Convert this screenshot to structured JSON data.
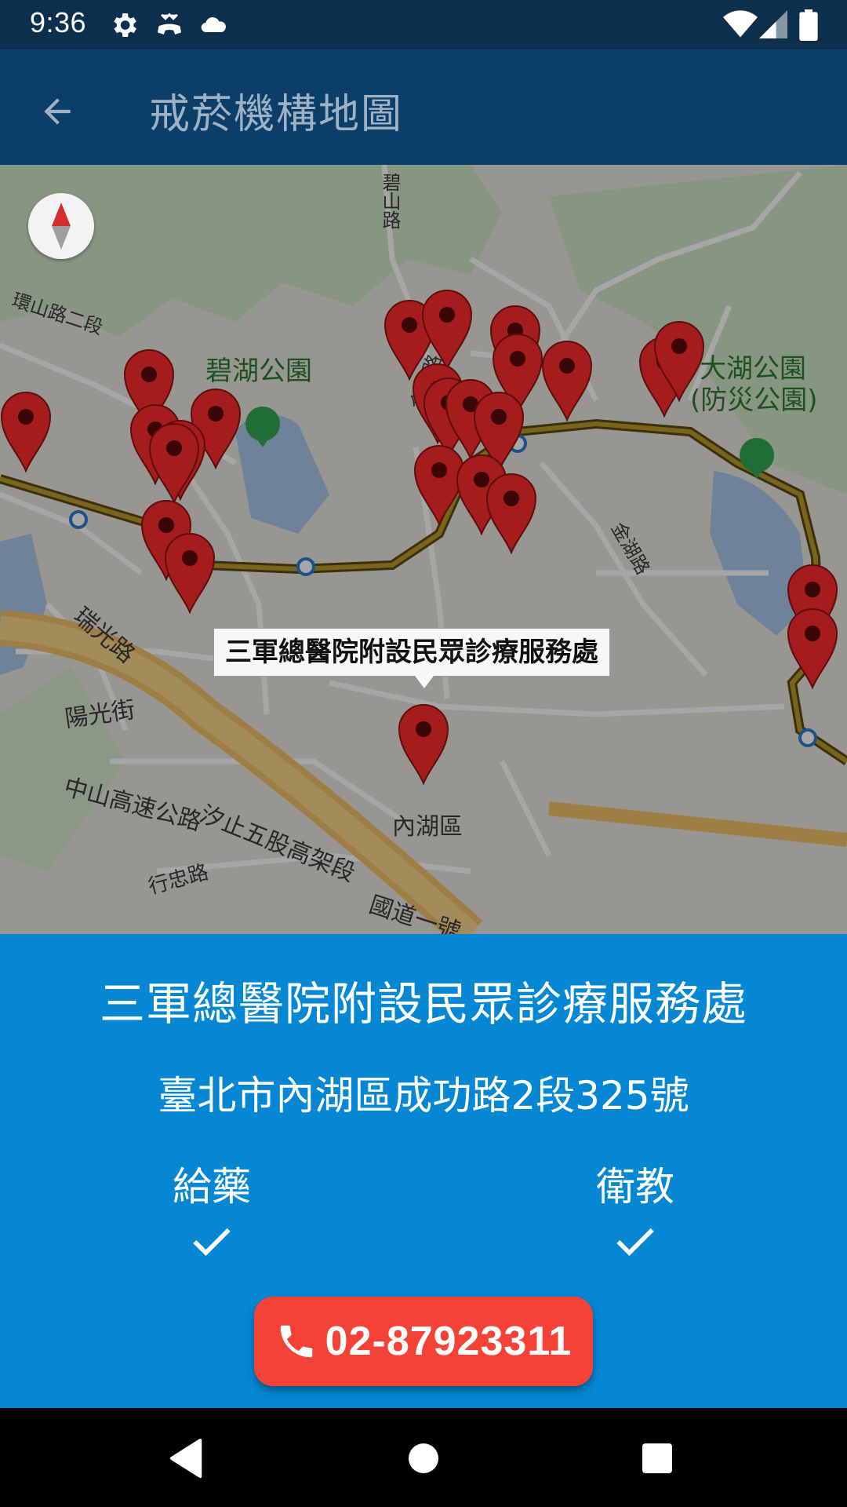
{
  "status_bar": {
    "time": "9:36",
    "icons": [
      "settings-icon",
      "call-end-icon",
      "cloud-icon",
      "wifi-icon",
      "signal-icon",
      "battery-icon"
    ]
  },
  "app_bar": {
    "title": "戒菸機構地圖",
    "back_icon": "arrow-back-icon",
    "background": "#0b3f69"
  },
  "map": {
    "labels": {
      "bishan_rd": "碧山路",
      "huanshan_rd": "環山路二段",
      "jinlong_rd": "金龍路",
      "jinhu_rd": "金湖路",
      "ruiguang_rd": "瑞光路",
      "yangguang_st": "陽光街",
      "zhongshan_fwy": "中山高速公路",
      "xizhi_viaduct": "汐止五股高架段",
      "xingzhong_rd": "行忠路",
      "national_hwy": "國道一號",
      "neihu_district": "內湖區"
    },
    "parks": {
      "bihu": "碧湖公園",
      "dahu_line1": "大湖公園",
      "dahu_line2": "(防災公園)"
    },
    "info_window": "三軍總醫院附設民眾診療服務處",
    "marker_color": "#a51c1c"
  },
  "detail": {
    "name": "三軍總醫院附設民眾診療服務處",
    "address": "臺北市內湖區成功路2段325號",
    "services": [
      {
        "label": "給藥",
        "available": true
      },
      {
        "label": "衛教",
        "available": true
      }
    ],
    "phone": "02-87923311",
    "panel_color": "#0587d4",
    "button_color": "#f44336"
  },
  "nav_bar": {
    "icons": [
      "back-triangle-icon",
      "home-circle-icon",
      "recents-square-icon"
    ]
  }
}
